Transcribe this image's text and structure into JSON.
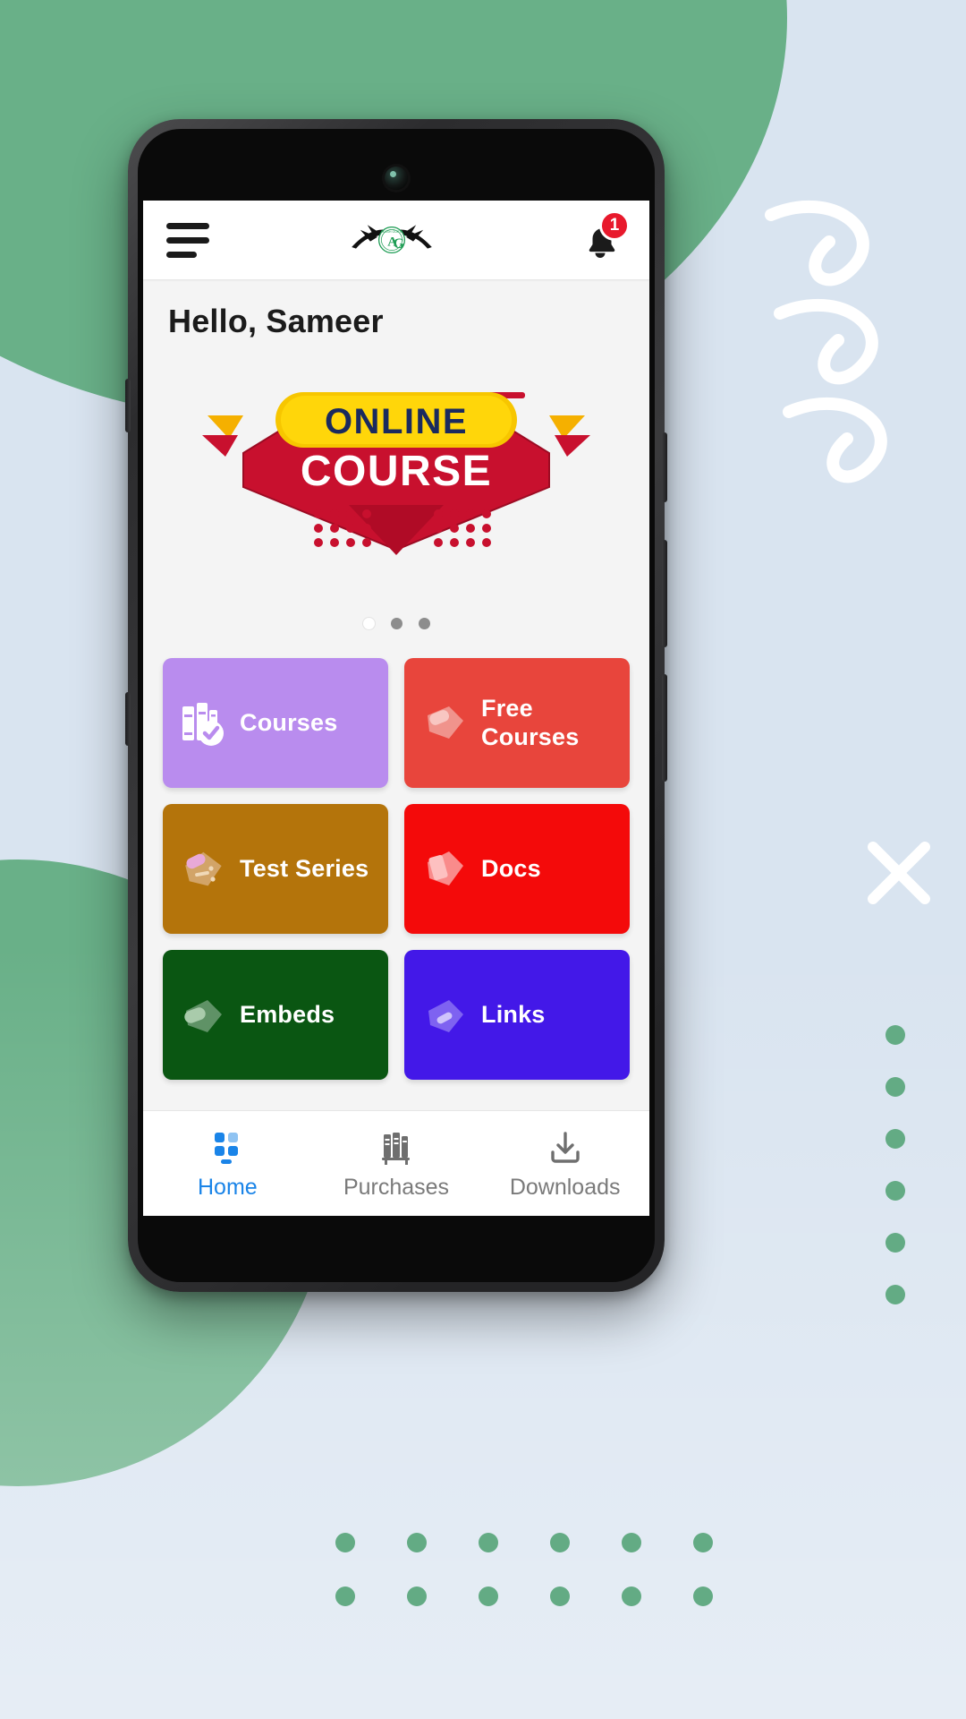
{
  "app": {
    "header": {
      "menu_icon": "hamburger-menu-icon",
      "logo_text": "AG",
      "logo_name": "ag-wings-logo",
      "bell_icon": "notification-bell-icon",
      "notification_count": "1"
    },
    "greeting": "Hello, Sameer",
    "banner": {
      "line1": "ONLINE",
      "line2": "COURSE",
      "name": "online-course-promo-banner"
    },
    "carousel": {
      "dot_count": 3,
      "active_index": 0
    },
    "tiles": [
      {
        "label": "Courses",
        "icon": "books-check-icon",
        "color": "#b98cee",
        "icon_tint": "#ffffff"
      },
      {
        "label": "Free Courses",
        "icon": "tag-icon",
        "color": "#e8453c",
        "icon_tint": "#f5a29c"
      },
      {
        "label": "Test Series",
        "icon": "test-paper-icon",
        "color": "#b4740b",
        "icon_tint": "#d8a86a"
      },
      {
        "label": "Docs",
        "icon": "document-tag-icon",
        "color": "#f40a0a",
        "icon_tint": "#fa8787"
      },
      {
        "label": "Embeds",
        "icon": "embed-tag-icon",
        "color": "#0a5612",
        "icon_tint": "#8ebe92"
      },
      {
        "label": "Links",
        "icon": "link-tag-icon",
        "color": "#4318e8",
        "icon_tint": "#8f77f2"
      }
    ],
    "bottom_nav": [
      {
        "label": "Home",
        "icon": "grid-dashboard-icon",
        "active": true
      },
      {
        "label": "Purchases",
        "icon": "books-shelf-icon",
        "active": false
      },
      {
        "label": "Downloads",
        "icon": "download-arrow-icon",
        "active": false
      }
    ]
  },
  "theme": {
    "accent_blue": "#1a84e8",
    "badge_red": "#e8192c",
    "background_green": "#69b088",
    "background_blue": "#d9e4f0",
    "screen_bg": "#f4f4f4"
  }
}
